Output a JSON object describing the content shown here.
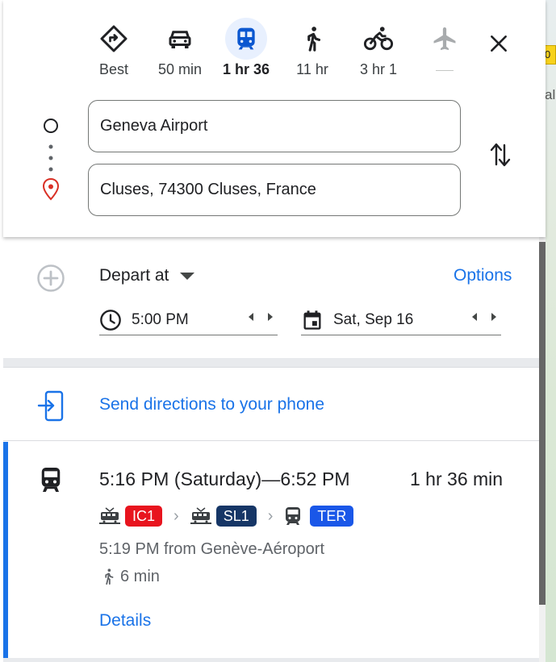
{
  "colors": {
    "accent": "#1a73e8",
    "active_mode_bg": "#e8f0fe",
    "ic1": "#e8141e",
    "sl1": "#163666",
    "ter": "#1a57e8"
  },
  "map": {
    "badge": "0",
    "side_text": "al"
  },
  "modes": [
    {
      "icon": "route-icon",
      "label": "Best"
    },
    {
      "icon": "car-icon",
      "label": "50 min"
    },
    {
      "icon": "train-icon",
      "label": "1 hr 36",
      "active": true
    },
    {
      "icon": "walk-icon",
      "label": "11 hr"
    },
    {
      "icon": "bike-icon",
      "label": "3 hr 1"
    },
    {
      "icon": "plane-icon",
      "label": "",
      "disabled": true
    }
  ],
  "route": {
    "origin": "Geneva Airport",
    "destination": "Cluses, 74300 Cluses, France"
  },
  "depart": {
    "mode_label": "Depart at",
    "options_label": "Options",
    "time": "5:00 PM",
    "date": "Sat, Sep 16"
  },
  "send": {
    "label": "Send directions to your phone"
  },
  "result": {
    "times": "5:16 PM (Saturday)—6:52 PM",
    "duration": "1 hr 36 min",
    "legs": [
      {
        "icon": "train-icon",
        "badge": "IC1"
      },
      {
        "icon": "train-icon",
        "badge": "SL1"
      },
      {
        "icon": "tram-icon",
        "badge": "TER"
      }
    ],
    "from": "5:19 PM from Genève-Aéroport",
    "walk": "6 min",
    "details_label": "Details"
  }
}
